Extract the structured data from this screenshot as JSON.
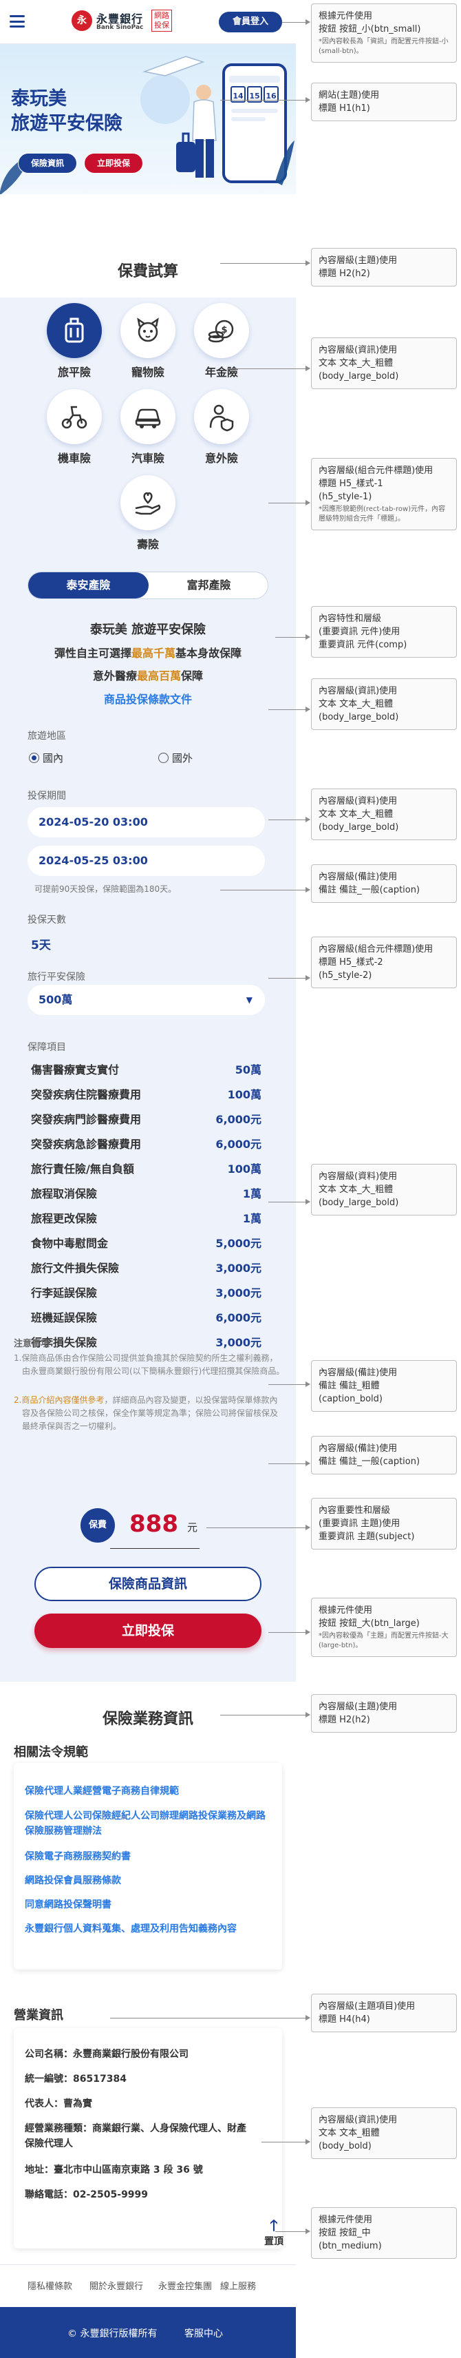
{
  "header": {
    "logo_mark": "永",
    "logo_name": "永豐銀行",
    "logo_english": "Bank SinoPac",
    "logo_tag": "網路投保",
    "login_label": "會員登入"
  },
  "hero": {
    "title_line1": "泰玩美",
    "title_line2": "旅遊平安保險",
    "info_button": "保險資訊",
    "buy_button": "立即投保",
    "calendar_days": [
      "14",
      "15",
      "16"
    ]
  },
  "trial": {
    "title": "保費試算",
    "products": [
      {
        "label": "旅平險",
        "icon": "luggage-icon"
      },
      {
        "label": "寵物險",
        "icon": "pet-icon"
      },
      {
        "label": "年金險",
        "icon": "coins-icon"
      },
      {
        "label": "機車險",
        "icon": "scooter-icon"
      },
      {
        "label": "汽車險",
        "icon": "car-icon"
      },
      {
        "label": "意外險",
        "icon": "person-shield-icon"
      },
      {
        "label": "壽險",
        "icon": "hand-heart-icon"
      }
    ],
    "segment": {
      "active": "泰安產險",
      "inactive": "富邦產險"
    }
  },
  "product": {
    "title": "泰玩美 旅遊平安保險",
    "line1_prefix": "彈性自主可選擇",
    "line1_highlight": "最高千萬",
    "line1_suffix": "基本身故保障",
    "line2_prefix": "意外醫療",
    "line2_highlight": "最高百萬",
    "line2_suffix": "保障",
    "terms_link": "商品投保條款文件"
  },
  "form": {
    "region_label": "旅遊地區",
    "region_domestic": "國內",
    "region_overseas": "國外",
    "period_label": "投保期間",
    "start": "2024-05-20 03:00",
    "end": "2024-05-25 03:00",
    "period_note": "可提前90天投保，保險範圍為180天。",
    "days_label": "投保天數",
    "days_value": "5天",
    "amount_label": "旅行平安保險",
    "amount_value": "500萬",
    "amount_chevron": "▼",
    "coverage_label": "保障項目",
    "coverage": [
      {
        "name": "傷害醫療實支實付",
        "value": "50萬"
      },
      {
        "name": "突發疾病住院醫療費用",
        "value": "100萬"
      },
      {
        "name": "突發疾病門診醫療費用",
        "value": "6,000元"
      },
      {
        "name": "突發疾病急診醫療費用",
        "value": "6,000元"
      },
      {
        "name": "旅行責任險/無自負額",
        "value": "100萬"
      },
      {
        "name": "旅程取消保險",
        "value": "1萬"
      },
      {
        "name": "旅程更改保險",
        "value": "1萬"
      },
      {
        "name": "食物中毒慰問金",
        "value": "5,000元"
      },
      {
        "name": "旅行文件損失保險",
        "value": "3,000元"
      },
      {
        "name": "行李延誤保險",
        "value": "3,000元"
      },
      {
        "name": "班機延誤保險",
        "value": "6,000元"
      },
      {
        "name": "行李損失保險",
        "value": "3,000元"
      }
    ]
  },
  "notes": {
    "title": "注意事項：",
    "item1": "1.保險商品係由合作保險公司提供並負擔其於保險契約所生之權利義務，由永豐商業銀行股份有限公司(以下簡稱永豐銀行)代理招攬其保險商品。",
    "item2_link": "2.商品介紹內容僅供參考",
    "item2_rest": "，詳細商品內容及變更，以投保當時保單條款內容及各保險公司之核保，保全作業等規定為準；保險公司將保留核保及最終承保與否之一切權利。"
  },
  "premium": {
    "badge": "保費",
    "value": "888",
    "unit": "元"
  },
  "actions": {
    "info": "保險商品資訊",
    "buy": "立即投保"
  },
  "business": {
    "title": "保險業務資訊",
    "laws_title": "相關法令規範",
    "laws": [
      "保險代理人業經營電子商務自律規範",
      "保險代理人公司保險經紀人公司辦理網路投保業務及網路保險服務管理辦法",
      "保險電子商務服務契約書",
      "網路投保會員服務條款",
      "同意網路投保聲明書",
      "永豐銀行個人資料蒐集、處理及利用告知義務內容"
    ],
    "org_title": "營業資訊",
    "org": [
      "公司名稱：永豐商業銀行股份有限公司",
      "統一編號：86517384",
      "代表人：曹為實",
      "經營業務種類：商業銀行業、人身保險代理人、財產保險代理人",
      "地址：臺北市中山區南京東路 3 段 36 號",
      "聯絡電話：02-2505-9999"
    ],
    "top_label": "置頂",
    "top_arrow": "🡑"
  },
  "footer_links": [
    "隱私權條款",
    "關於永豐銀行",
    "永豐金控集團",
    "線上服務"
  ],
  "footer": {
    "copyright": "© 永豐銀行版權所有",
    "service": "客服中心"
  },
  "annotations": [
    {
      "text": "根據元件使用\n按鈕 按鈕_小(btn_small)",
      "small": "*因內容較長為「資訊」而配置元件按鈕-小(small-btn)。"
    },
    {
      "text": "網站(主題)使用\n標題 H1(h1)",
      "small": ""
    },
    {
      "text": "內容層級(主題)使用\n標題 H2(h2)",
      "small": ""
    },
    {
      "text": "內容層級(資訊)使用\n文本 文本_大_粗體\n(body_large_bold)",
      "small": ""
    },
    {
      "text": "內容層級(組合元件標題)使用\n標題 H5_樣式-1\n(h5_style-1)",
      "small": "*因應形貌範例(rect-tab-row)元件，內容層級特別組合元件「標題」。"
    },
    {
      "text": "內容特性和層級\n(重要資訊 元件)使用\n重要資訊 元件(comp)",
      "small": ""
    },
    {
      "text": "內容層級(資訊)使用\n文本 文本_大_粗體\n(body_large_bold)",
      "small": ""
    },
    {
      "text": "內容層級(資料)使用\n文本 文本_大_粗體\n(body_large_bold)",
      "small": ""
    },
    {
      "text": "內容層級(備註)使用\n備註 備註_一般(caption)",
      "small": ""
    },
    {
      "text": "內容層級(組合元件標題)使用\n標題 H5_樣式-2\n(h5_style-2)",
      "small": ""
    },
    {
      "text": "內容層級(資料)使用\n文本 文本_大_粗體\n(body_large_bold)",
      "small": ""
    },
    {
      "text": "內容層級(備註)使用\n備註 備註_粗體\n(caption_bold)",
      "small": ""
    },
    {
      "text": "內容層級(備註)使用\n備註 備註_一般(caption)",
      "small": ""
    },
    {
      "text": "內容重要性和層級\n(重要資訊 主題)使用\n重要資訊 主題(subject)",
      "small": ""
    },
    {
      "text": "根據元件使用\n按鈕 按鈕_大(btn_large)",
      "small": "*因內容較優為「主題」而配置元件按鈕-大(large-btn)。"
    },
    {
      "text": "內容層級(主題)使用\n標題 H2(h2)",
      "small": ""
    },
    {
      "text": "內容層級(主題項目)使用\n標題 H4(h4)",
      "small": ""
    },
    {
      "text": "內容層級(資訊)使用\n文本 文本_粗體\n(body_bold)",
      "small": ""
    },
    {
      "text": "根據元件使用\n按鈕 按鈕_中\n(btn_medium)",
      "small": ""
    }
  ]
}
